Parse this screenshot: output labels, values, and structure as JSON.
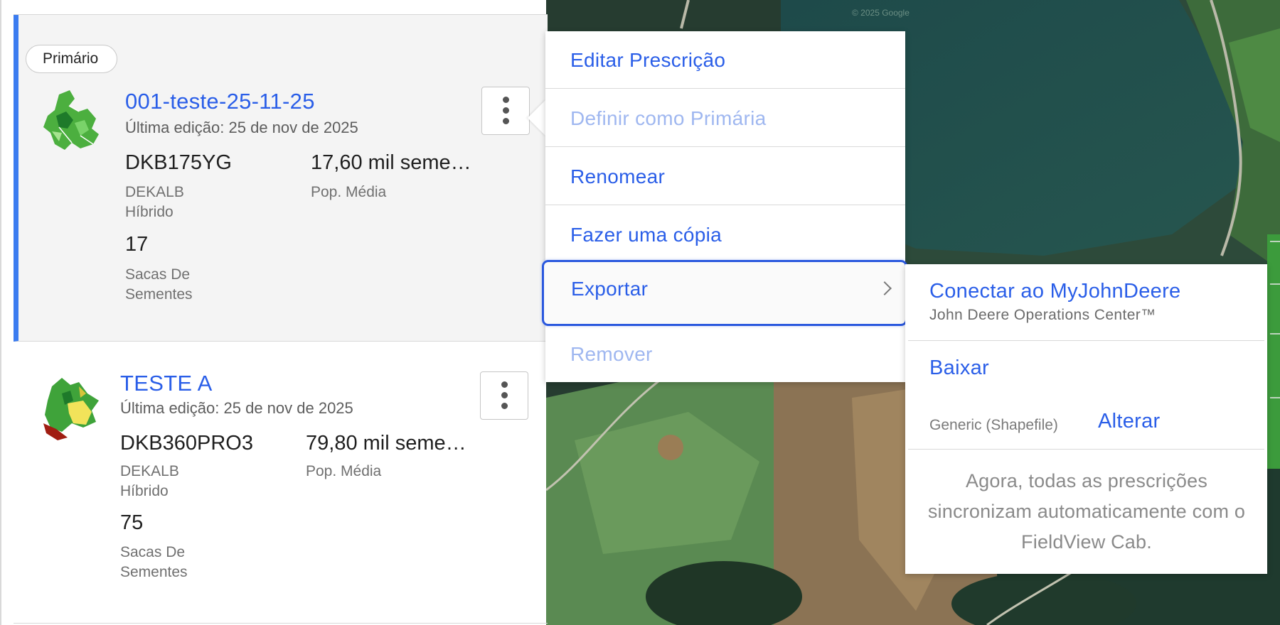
{
  "cards": [
    {
      "badge": "Primário",
      "title": "001-teste-25-11-25",
      "edited": "Última edição: 25 de nov de 2025",
      "hybrid_name": "DKB175YG",
      "brand": "DEKALB",
      "type": "Híbrido",
      "population": "17,60 mil seme…",
      "population_label": "Pop. Média",
      "bags": "17",
      "bags_label_1": "Sacas De",
      "bags_label_2": "Sementes"
    },
    {
      "title": "TESTE A",
      "edited": "Última edição: 25 de nov de 2025",
      "hybrid_name": "DKB360PRO3",
      "brand": "DEKALB",
      "type": "Híbrido",
      "population": "79,80 mil seme…",
      "population_label": "Pop. Média",
      "bags": "75",
      "bags_label_1": "Sacas De",
      "bags_label_2": "Sementes"
    }
  ],
  "menu": {
    "items": [
      {
        "label": "Editar Prescrição",
        "enabled": true
      },
      {
        "label": "Definir como Primária",
        "enabled": false
      },
      {
        "label": "Renomear",
        "enabled": true
      },
      {
        "label": "Fazer uma cópia",
        "enabled": true
      },
      {
        "label": "Exportar",
        "enabled": true,
        "focused": true
      },
      {
        "label": "Remover",
        "enabled": false
      }
    ]
  },
  "export_submenu": {
    "connect_label": "Conectar ao MyJohnDeere",
    "connect_desc": "John Deere Operations Center™",
    "download_label": "Baixar",
    "format": "Generic (Shapefile)",
    "change_label": "Alterar",
    "note": "Agora, todas as prescrições sincronizam automaticamente com o FieldView Cab."
  },
  "map": {
    "copyright": "© 2025 Google"
  },
  "colors": {
    "accent": "#2a5ee8",
    "selected_bar": "#3b7cf0",
    "disabled": "#9fb7f0"
  }
}
